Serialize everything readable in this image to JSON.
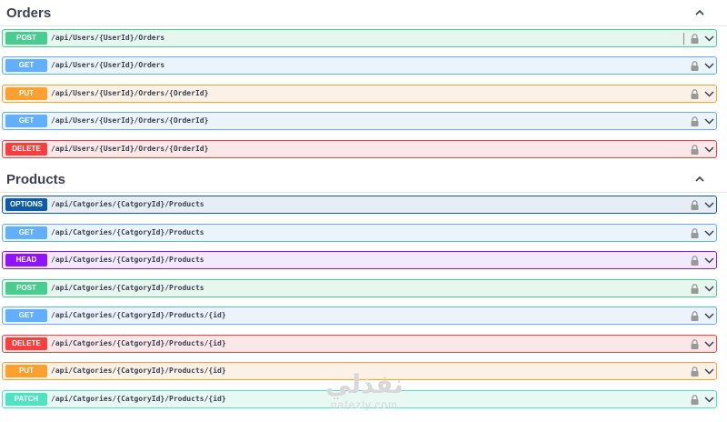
{
  "sections": [
    {
      "title": "Orders",
      "operations": [
        {
          "method": "POST",
          "path": "/api/Users/{UserId}/Orders",
          "kind": "post"
        },
        {
          "method": "GET",
          "path": "/api/Users/{UserId}/Orders",
          "kind": "get"
        },
        {
          "method": "PUT",
          "path": "/api/Users/{UserId}/Orders/{OrderId}",
          "kind": "put"
        },
        {
          "method": "GET",
          "path": "/api/Users/{UserId}/Orders/{OrderId}",
          "kind": "get"
        },
        {
          "method": "DELETE",
          "path": "/api/Users/{UserId}/Orders/{OrderId}",
          "kind": "delete"
        }
      ]
    },
    {
      "title": "Products",
      "operations": [
        {
          "method": "OPTIONS",
          "path": "/api/Catgories/{CatgoryId}/Products",
          "kind": "options"
        },
        {
          "method": "GET",
          "path": "/api/Catgories/{CatgoryId}/Products",
          "kind": "get"
        },
        {
          "method": "HEAD",
          "path": "/api/Catgories/{CatgoryId}/Products",
          "kind": "head"
        },
        {
          "method": "POST",
          "path": "/api/Catgories/{CatgoryId}/Products",
          "kind": "post"
        },
        {
          "method": "GET",
          "path": "/api/Catgories/{CatgoryId}/Products/{id}",
          "kind": "get"
        },
        {
          "method": "DELETE",
          "path": "/api/Catgories/{CatgoryId}/Products/{id}",
          "kind": "delete"
        },
        {
          "method": "PUT",
          "path": "/api/Catgories/{CatgoryId}/Products/{id}",
          "kind": "put"
        },
        {
          "method": "PATCH",
          "path": "/api/Catgories/{CatgoryId}/Products/{id}",
          "kind": "patch"
        }
      ]
    }
  ],
  "watermark": {
    "logo": "نفذلي",
    "text": "nafezly.com"
  },
  "colors": {
    "post": "#49cc90",
    "get": "#61affe",
    "put": "#fca130",
    "delete": "#f93e3e",
    "options": "#0d5aa7",
    "head": "#9012fe",
    "patch": "#50e3c2"
  },
  "icons": {
    "collapse": "chevron-up-icon",
    "lock": "lock-icon",
    "expand": "chevron-down-icon"
  }
}
